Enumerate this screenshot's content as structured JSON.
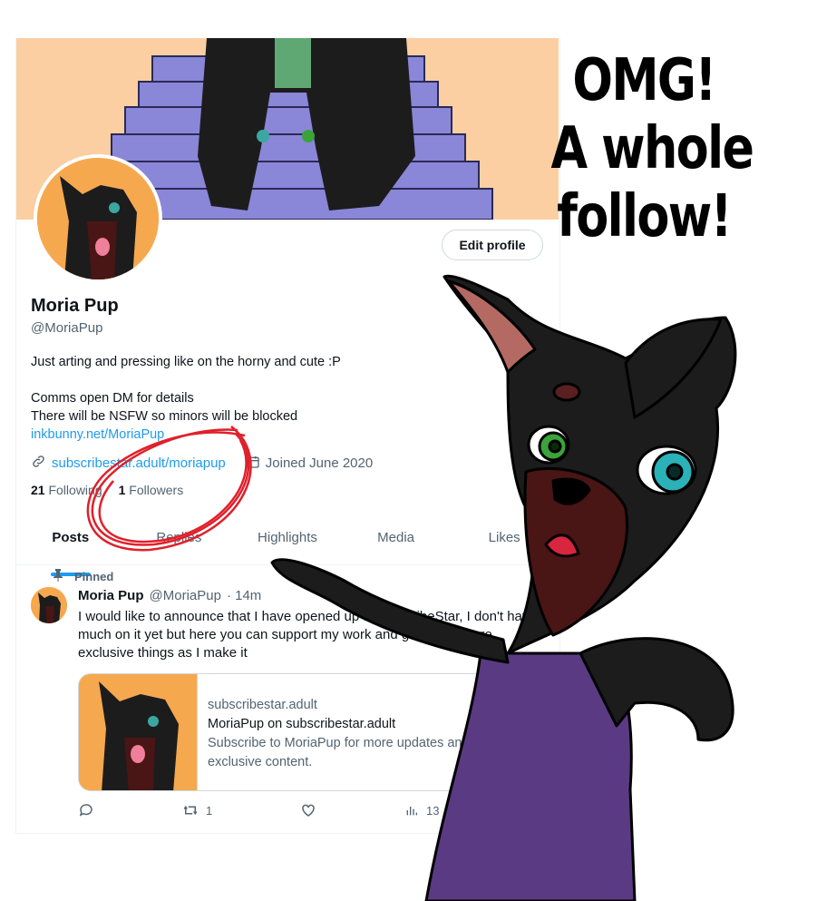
{
  "profile": {
    "edit_button": "Edit profile",
    "name": "Moria Pup",
    "handle": "@MoriaPup",
    "bio_line1": "Just arting and pressing like on the horny and cute :P",
    "bio_line2": "Comms open DM for details",
    "bio_line3": "There will be NSFW so minors will be blocked",
    "bio_link": "inkbunny.net/MoriaPup",
    "website": "subscribestar.adult/moriapup",
    "joined": "Joined June 2020",
    "following_count": "21",
    "following_label": "Following",
    "followers_count": "1",
    "followers_label": "Followers"
  },
  "tabs": [
    {
      "label": "Posts"
    },
    {
      "label": "Replies"
    },
    {
      "label": "Highlights"
    },
    {
      "label": "Media"
    },
    {
      "label": "Likes"
    }
  ],
  "tweet": {
    "pinned_label": "Pinned",
    "author": "Moria Pup",
    "handle": "@MoriaPup",
    "time": "· 14m",
    "text": "I would like to announce that I have opened up a SubscribeStar, I don't have much on it yet but here you can support my work and get some more exclusive things as I make it",
    "card_domain": "subscribestar.adult",
    "card_title": "MoriaPup on subscribestar.adult",
    "card_desc": "Subscribe to MoriaPup for more updates and exclusive content.",
    "retweets": "1",
    "views": "13"
  },
  "meme": {
    "line1": "OMG!",
    "line2": "A whole",
    "line3": "follow!"
  },
  "colors": {
    "link": "#1d9bf0",
    "banner": "#fbcfa2",
    "avatar_bg": "#f6a84e",
    "stairs": "#8a86d8",
    "fur": "#1c1c1c",
    "shirt": "#5b3a84",
    "circle": "#e0202a"
  }
}
